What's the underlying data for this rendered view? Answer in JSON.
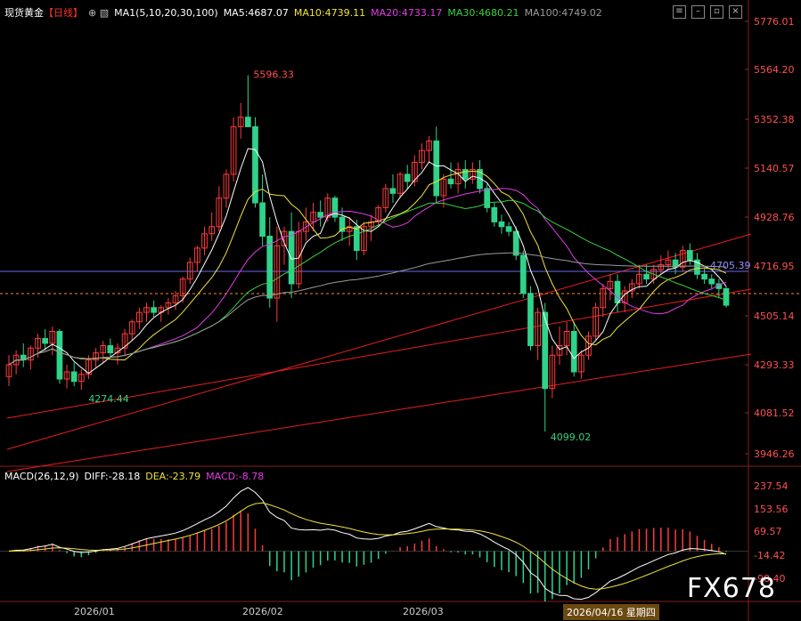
{
  "header": {
    "symbol": "现货黄金",
    "period": "【日线】",
    "indicator": "MA1(5,10,20,30,100)",
    "ma5": "MA5:4687.07",
    "ma10": "MA10:4739.11",
    "ma20": "MA20:4733.17",
    "ma30": "MA30:4680.21",
    "ma100": "MA100:4749.02"
  },
  "macd_header": {
    "name": "MACD(26,12,9)",
    "diff": "DIFF:-28.18",
    "dea": "DEA:-23.79",
    "macd": "MACD:-8.78"
  },
  "brand": "FX678",
  "cursor_date": "2026/04/16 星期四",
  "colors": {
    "up": "#ff3b3b",
    "down": "#2fd38a",
    "ma5": "#ffffff",
    "ma10": "#f2e33a",
    "ma20": "#e23ce6",
    "ma30": "#39d13f",
    "ma100": "#9a9a9a",
    "trend": "#e81e1e",
    "hline": "#6a6ae8",
    "price_dash": "#ff8a1f"
  },
  "chart_data": {
    "type": "candlestick",
    "title": "现货黄金【日线】",
    "price_axis_ticks": [
      "5776.01",
      "5564.20",
      "5352.38",
      "5140.57",
      "4928.76",
      "4716.95",
      "4505.14",
      "4293.33",
      "4081.52",
      "3946.26"
    ],
    "macd_axis_ticks": [
      "237.54",
      "153.56",
      "69.57",
      "-14.42",
      "-98.40"
    ],
    "x_labels": [
      "2026/01",
      "2026/02",
      "2026/03"
    ],
    "annotations": {
      "high": "5596.33",
      "low_jan": "4274.44",
      "low_mar": "4099.02",
      "horizontal_line": "4705.39"
    },
    "ylim": [
      3946.26,
      5830
    ],
    "candles": [
      [
        4330,
        4420,
        4290,
        4380
      ],
      [
        4380,
        4440,
        4340,
        4420
      ],
      [
        4420,
        4470,
        4370,
        4400
      ],
      [
        4400,
        4460,
        4360,
        4450
      ],
      [
        4450,
        4510,
        4410,
        4490
      ],
      [
        4490,
        4530,
        4440,
        4470
      ],
      [
        4470,
        4540,
        4420,
        4520
      ],
      [
        4520,
        4530,
        4300,
        4320
      ],
      [
        4320,
        4380,
        4280,
        4350
      ],
      [
        4350,
        4390,
        4290,
        4310
      ],
      [
        4310,
        4360,
        4274.44,
        4340
      ],
      [
        4340,
        4420,
        4320,
        4400
      ],
      [
        4400,
        4450,
        4370,
        4430
      ],
      [
        4430,
        4480,
        4390,
        4460
      ],
      [
        4460,
        4490,
        4410,
        4430
      ],
      [
        4430,
        4470,
        4380,
        4450
      ],
      [
        4450,
        4530,
        4420,
        4510
      ],
      [
        4510,
        4570,
        4480,
        4560
      ],
      [
        4560,
        4620,
        4530,
        4600
      ],
      [
        4600,
        4640,
        4560,
        4620
      ],
      [
        4620,
        4650,
        4580,
        4600
      ],
      [
        4600,
        4630,
        4560,
        4620
      ],
      [
        4620,
        4660,
        4590,
        4640
      ],
      [
        4640,
        4690,
        4610,
        4670
      ],
      [
        4670,
        4750,
        4640,
        4740
      ],
      [
        4740,
        4830,
        4720,
        4810
      ],
      [
        4810,
        4880,
        4770,
        4870
      ],
      [
        4870,
        4960,
        4840,
        4930
      ],
      [
        4930,
        5020,
        4900,
        4960
      ],
      [
        4960,
        5130,
        4940,
        5080
      ],
      [
        5080,
        5200,
        5040,
        5180
      ],
      [
        5180,
        5420,
        5150,
        5380
      ],
      [
        5380,
        5480,
        5330,
        5420
      ],
      [
        5420,
        5596.33,
        5380,
        5380
      ],
      [
        5380,
        5420,
        5040,
        5060
      ],
      [
        5060,
        5180,
        4880,
        4920
      ],
      [
        4920,
        5000,
        4620,
        4660
      ],
      [
        4660,
        4960,
        4560,
        4880
      ],
      [
        4880,
        4960,
        4800,
        4940
      ],
      [
        4940,
        5020,
        4660,
        4720
      ],
      [
        4720,
        4980,
        4700,
        4940
      ],
      [
        4940,
        5040,
        4900,
        4980
      ],
      [
        4980,
        5060,
        4940,
        5020
      ],
      [
        5020,
        5070,
        4960,
        5000
      ],
      [
        5000,
        5100,
        4980,
        5080
      ],
      [
        5080,
        5090,
        4980,
        5000
      ],
      [
        5000,
        5040,
        4900,
        4940
      ],
      [
        4940,
        5000,
        4880,
        4960
      ],
      [
        4960,
        4990,
        4820,
        4860
      ],
      [
        4860,
        4980,
        4840,
        4960
      ],
      [
        4960,
        5010,
        4900,
        4980
      ],
      [
        4980,
        5050,
        4960,
        5040
      ],
      [
        5040,
        5140,
        5020,
        5120
      ],
      [
        5120,
        5180,
        5060,
        5100
      ],
      [
        5100,
        5190,
        5080,
        5180
      ],
      [
        5180,
        5220,
        5120,
        5150
      ],
      [
        5150,
        5260,
        5130,
        5230
      ],
      [
        5230,
        5310,
        5200,
        5280
      ],
      [
        5280,
        5340,
        5230,
        5320
      ],
      [
        5320,
        5380,
        5060,
        5090
      ],
      [
        5090,
        5180,
        5040,
        5160
      ],
      [
        5160,
        5230,
        5120,
        5140
      ],
      [
        5140,
        5230,
        5100,
        5200
      ],
      [
        5200,
        5240,
        5120,
        5160
      ],
      [
        5160,
        5230,
        5140,
        5200
      ],
      [
        5200,
        5240,
        5100,
        5120
      ],
      [
        5120,
        5140,
        5020,
        5040
      ],
      [
        5040,
        5060,
        4960,
        4980
      ],
      [
        4980,
        5010,
        4930,
        4960
      ],
      [
        4960,
        4980,
        4920,
        4940
      ],
      [
        4940,
        4960,
        4820,
        4840
      ],
      [
        4840,
        4860,
        4660,
        4680
      ],
      [
        4680,
        4710,
        4440,
        4460
      ],
      [
        4460,
        4620,
        4400,
        4600
      ],
      [
        4600,
        4640,
        4099.02,
        4280
      ],
      [
        4280,
        4460,
        4240,
        4420
      ],
      [
        4420,
        4540,
        4380,
        4460
      ],
      [
        4460,
        4560,
        4420,
        4520
      ],
      [
        4520,
        4560,
        4330,
        4350
      ],
      [
        4350,
        4440,
        4320,
        4420
      ],
      [
        4420,
        4520,
        4400,
        4500
      ],
      [
        4500,
        4640,
        4480,
        4620
      ],
      [
        4620,
        4720,
        4580,
        4700
      ],
      [
        4700,
        4760,
        4650,
        4730
      ],
      [
        4730,
        4760,
        4600,
        4640
      ],
      [
        4640,
        4710,
        4600,
        4690
      ],
      [
        4690,
        4740,
        4660,
        4720
      ],
      [
        4720,
        4800,
        4700,
        4760
      ],
      [
        4760,
        4800,
        4720,
        4740
      ],
      [
        4740,
        4800,
        4720,
        4780
      ],
      [
        4780,
        4840,
        4760,
        4800
      ],
      [
        4800,
        4860,
        4780,
        4820
      ],
      [
        4820,
        4850,
        4760,
        4790
      ],
      [
        4790,
        4880,
        4770,
        4860
      ],
      [
        4860,
        4890,
        4800,
        4820
      ],
      [
        4820,
        4850,
        4740,
        4760
      ],
      [
        4760,
        4790,
        4720,
        4740
      ],
      [
        4740,
        4760,
        4700,
        4720
      ],
      [
        4720,
        4740,
        4660,
        4700
      ],
      [
        4700,
        4710,
        4620,
        4630
      ]
    ]
  }
}
